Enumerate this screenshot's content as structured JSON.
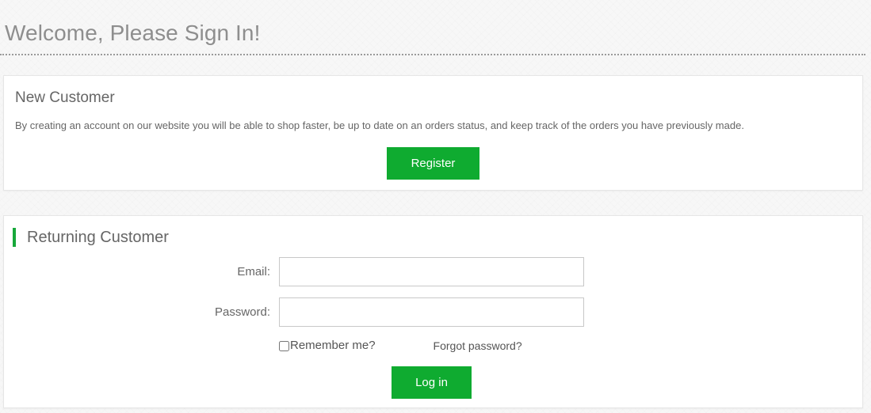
{
  "page": {
    "title": "Welcome, Please Sign In!",
    "accent_color": "#0fab30",
    "background_color": "#f7f7f7"
  },
  "new_customer": {
    "heading": "New Customer",
    "description": "By creating an account on our website you will be able to shop faster, be up to date on an orders status, and keep track of the orders you have previously made.",
    "register_label": "Register"
  },
  "returning_customer": {
    "heading": "Returning Customer",
    "email": {
      "label": "Email:",
      "value": "",
      "placeholder": ""
    },
    "password": {
      "label": "Password:",
      "value": "",
      "placeholder": ""
    },
    "remember_me_label": "Remember me?",
    "remember_me_checked": false,
    "forgot_password_label": "Forgot password?",
    "login_label": "Log in"
  }
}
